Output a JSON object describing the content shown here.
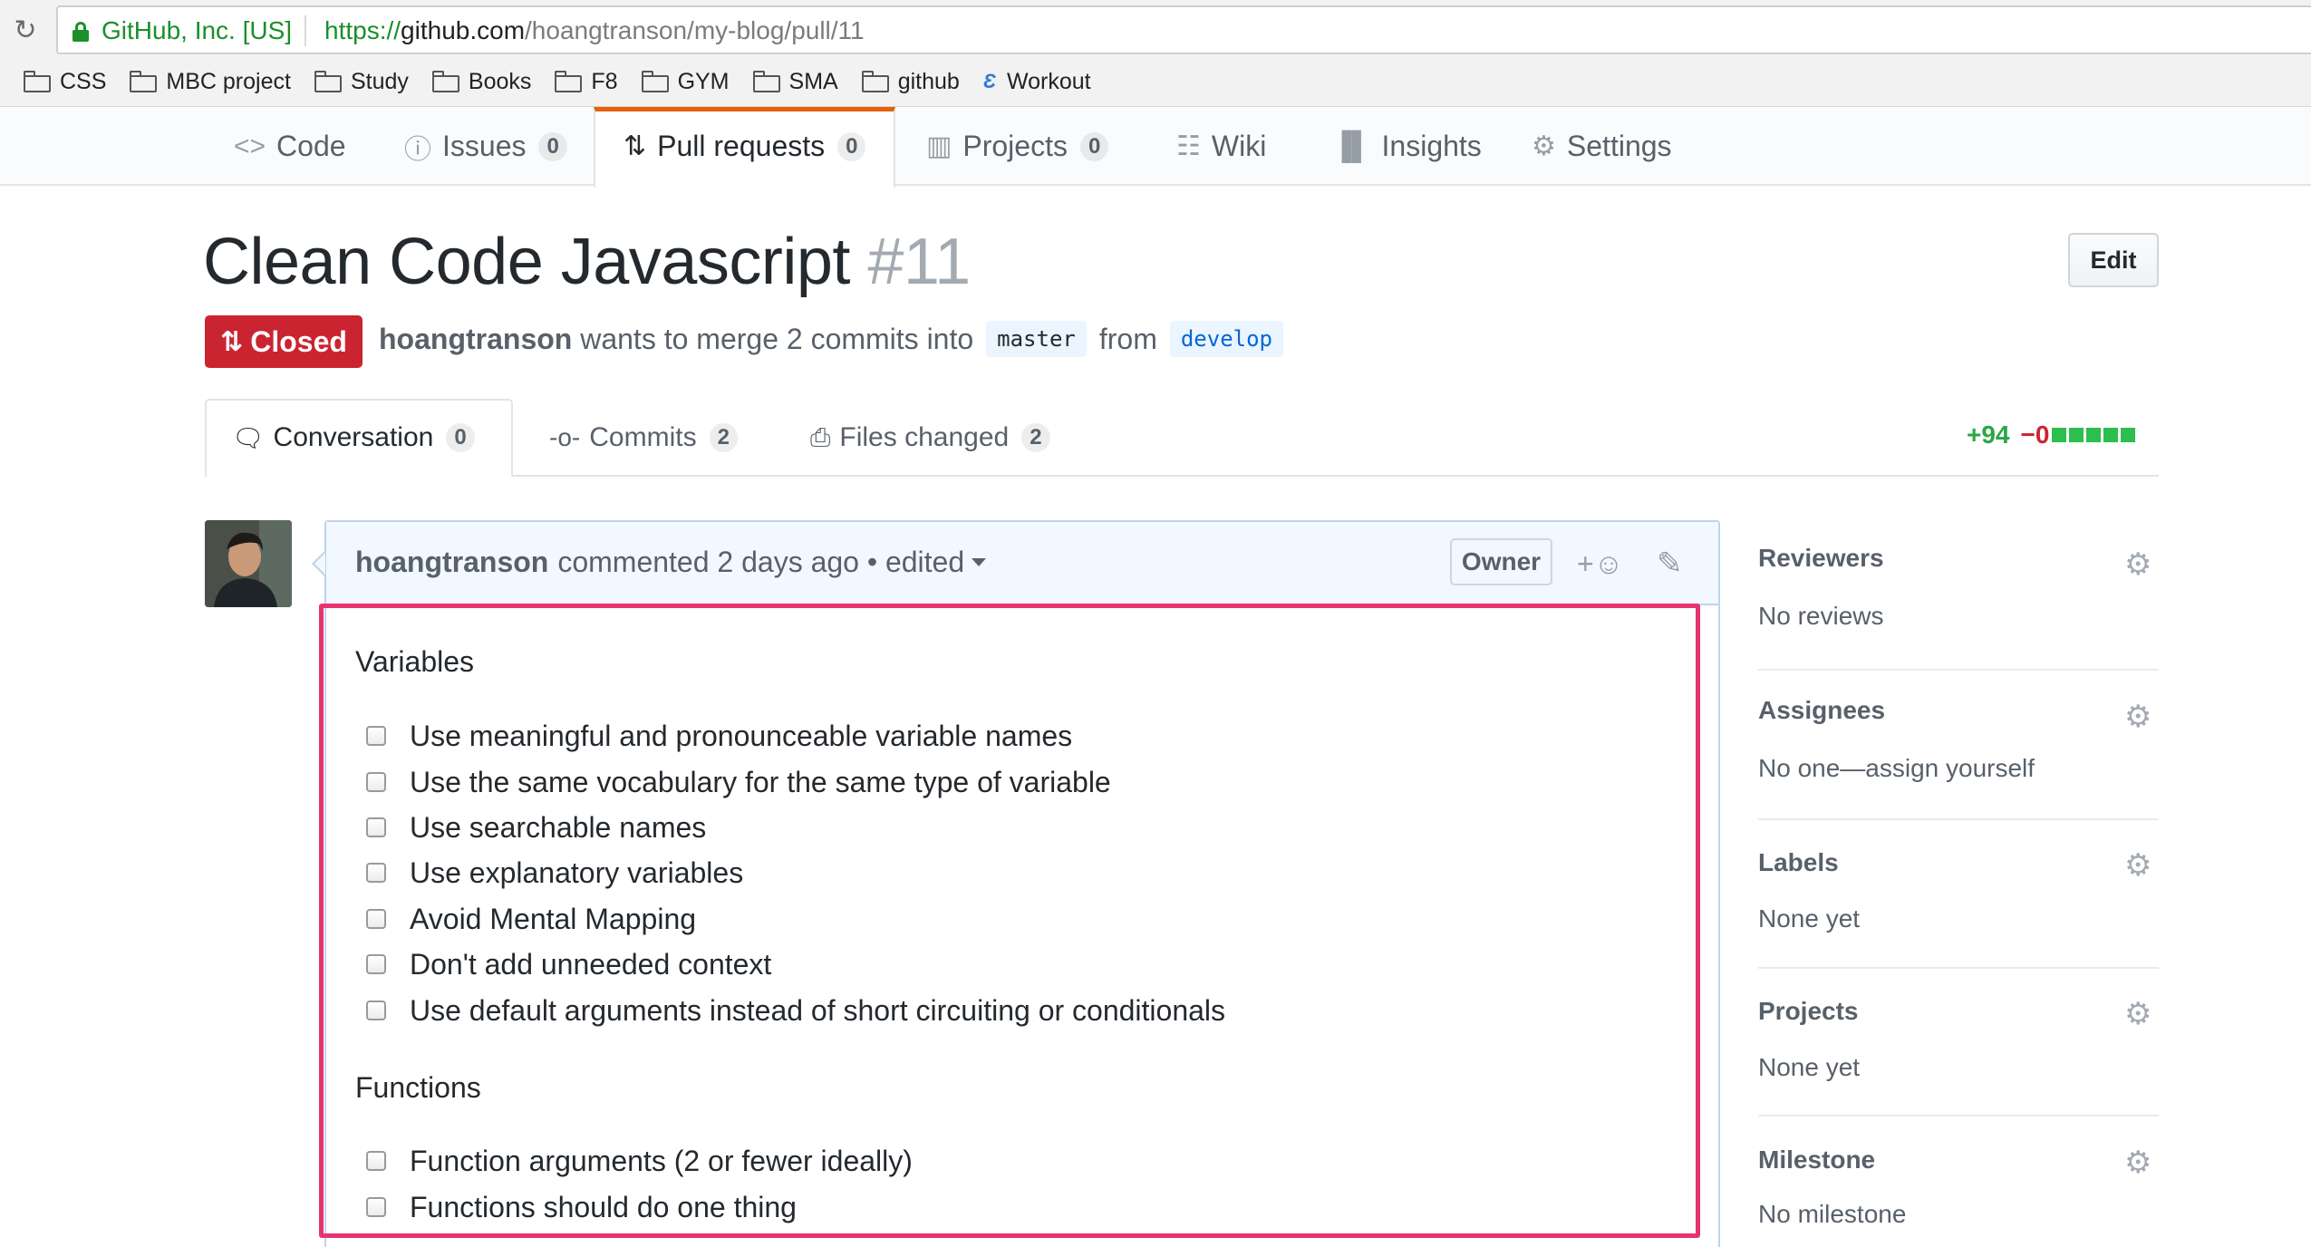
{
  "browser": {
    "secure_label": "GitHub, Inc. [US]",
    "url_scheme": "https://",
    "url_host": "github.com",
    "url_path": "/hoangtranson/my-blog/pull/11",
    "bookmarks": [
      "CSS",
      "MBC project",
      "Study",
      "Books",
      "F8",
      "GYM",
      "SMA",
      "github",
      "Workout"
    ]
  },
  "reponav": {
    "code": "Code",
    "issues": "Issues",
    "issues_count": "0",
    "pulls": "Pull requests",
    "pulls_count": "0",
    "projects": "Projects",
    "projects_count": "0",
    "wiki": "Wiki",
    "insights": "Insights",
    "settings": "Settings",
    "selected_accent": "#e36209"
  },
  "pr": {
    "title": "Clean Code Javascript",
    "number": "#11",
    "edit_label": "Edit",
    "state": "Closed",
    "state_color": "#cb2431",
    "author": "hoangtranson",
    "merge_text": "wants to merge 2 commits into",
    "base_branch": "master",
    "from_text": "from",
    "head_branch": "develop"
  },
  "tabs": {
    "conversation": "Conversation",
    "conversation_count": "0",
    "commits": "Commits",
    "commits_count": "2",
    "files": "Files changed",
    "files_count": "2",
    "additions": "+94",
    "deletions": "−0"
  },
  "comment": {
    "author": "hoangtranson",
    "action": "commented 2 days ago",
    "bullet": "•",
    "edited": "edited",
    "owner_label": "Owner",
    "reaction_plus": "+",
    "sections": [
      {
        "title": "Variables",
        "tasks": [
          "Use meaningful and pronounceable variable names",
          "Use the same vocabulary for the same type of variable",
          "Use searchable names",
          "Use explanatory variables",
          "Avoid Mental Mapping",
          "Don't add unneeded context",
          "Use default arguments instead of short circuiting or conditionals"
        ]
      },
      {
        "title": "Functions",
        "tasks": [
          "Function arguments (2 or fewer ideally)",
          "Functions should do one thing"
        ]
      }
    ],
    "highlight_color": "#e7336e"
  },
  "sidebar": {
    "reviewers": {
      "title": "Reviewers",
      "value": "No reviews"
    },
    "assignees": {
      "title": "Assignees",
      "value": "No one—assign yourself"
    },
    "labels": {
      "title": "Labels",
      "value": "None yet"
    },
    "projects": {
      "title": "Projects",
      "value": "None yet"
    },
    "milestone": {
      "title": "Milestone",
      "value": "No milestone"
    }
  }
}
